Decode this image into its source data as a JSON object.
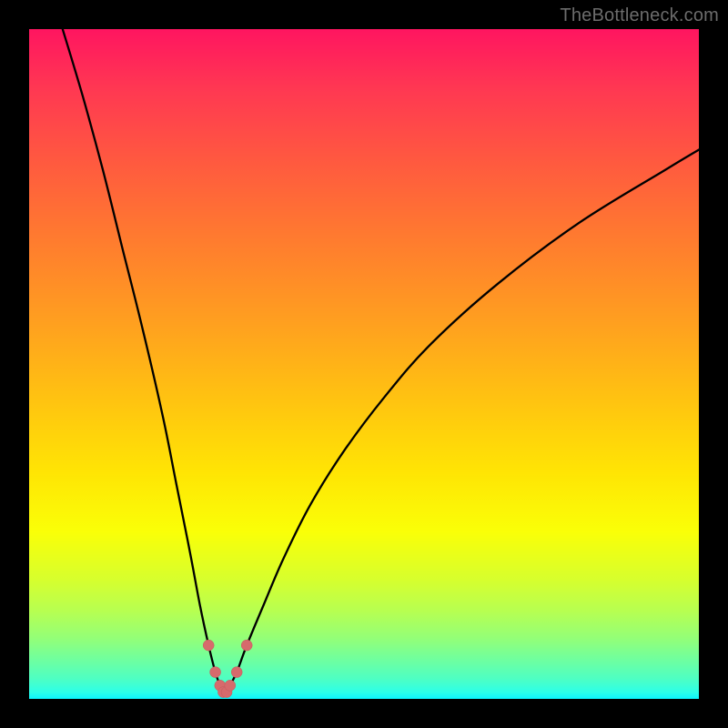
{
  "watermark": "TheBottleneck.com",
  "chart_data": {
    "type": "line",
    "title": "",
    "xlabel": "",
    "ylabel": "",
    "xlim": [
      0,
      100
    ],
    "ylim": [
      0,
      100
    ],
    "grid": false,
    "series": [
      {
        "name": "bottleneck-curve",
        "x": [
          5,
          8,
          11,
          14,
          17,
          20,
          22,
          24,
          25.5,
          26.8,
          27.8,
          28.5,
          29,
          29.5,
          30,
          31,
          32.5,
          35,
          38,
          42,
          47,
          53,
          60,
          70,
          82,
          95,
          100
        ],
        "y": [
          100,
          90,
          79,
          67,
          55,
          42,
          32,
          22,
          14,
          8,
          4,
          2,
          1,
          1,
          2,
          4,
          8,
          14,
          21,
          29,
          37,
          45,
          53,
          62,
          71,
          79,
          82
        ]
      }
    ],
    "markers": {
      "name": "highlight-points",
      "x": [
        26.8,
        27.8,
        28.5,
        29,
        29.5,
        30,
        31,
        32.5
      ],
      "y": [
        8,
        4,
        2,
        1,
        1,
        2,
        4,
        8
      ],
      "color": "#d66a6c"
    },
    "background_gradient": {
      "top": "#ff1560",
      "mid": "#ffe404",
      "bottom": "#0cf5ff"
    }
  }
}
